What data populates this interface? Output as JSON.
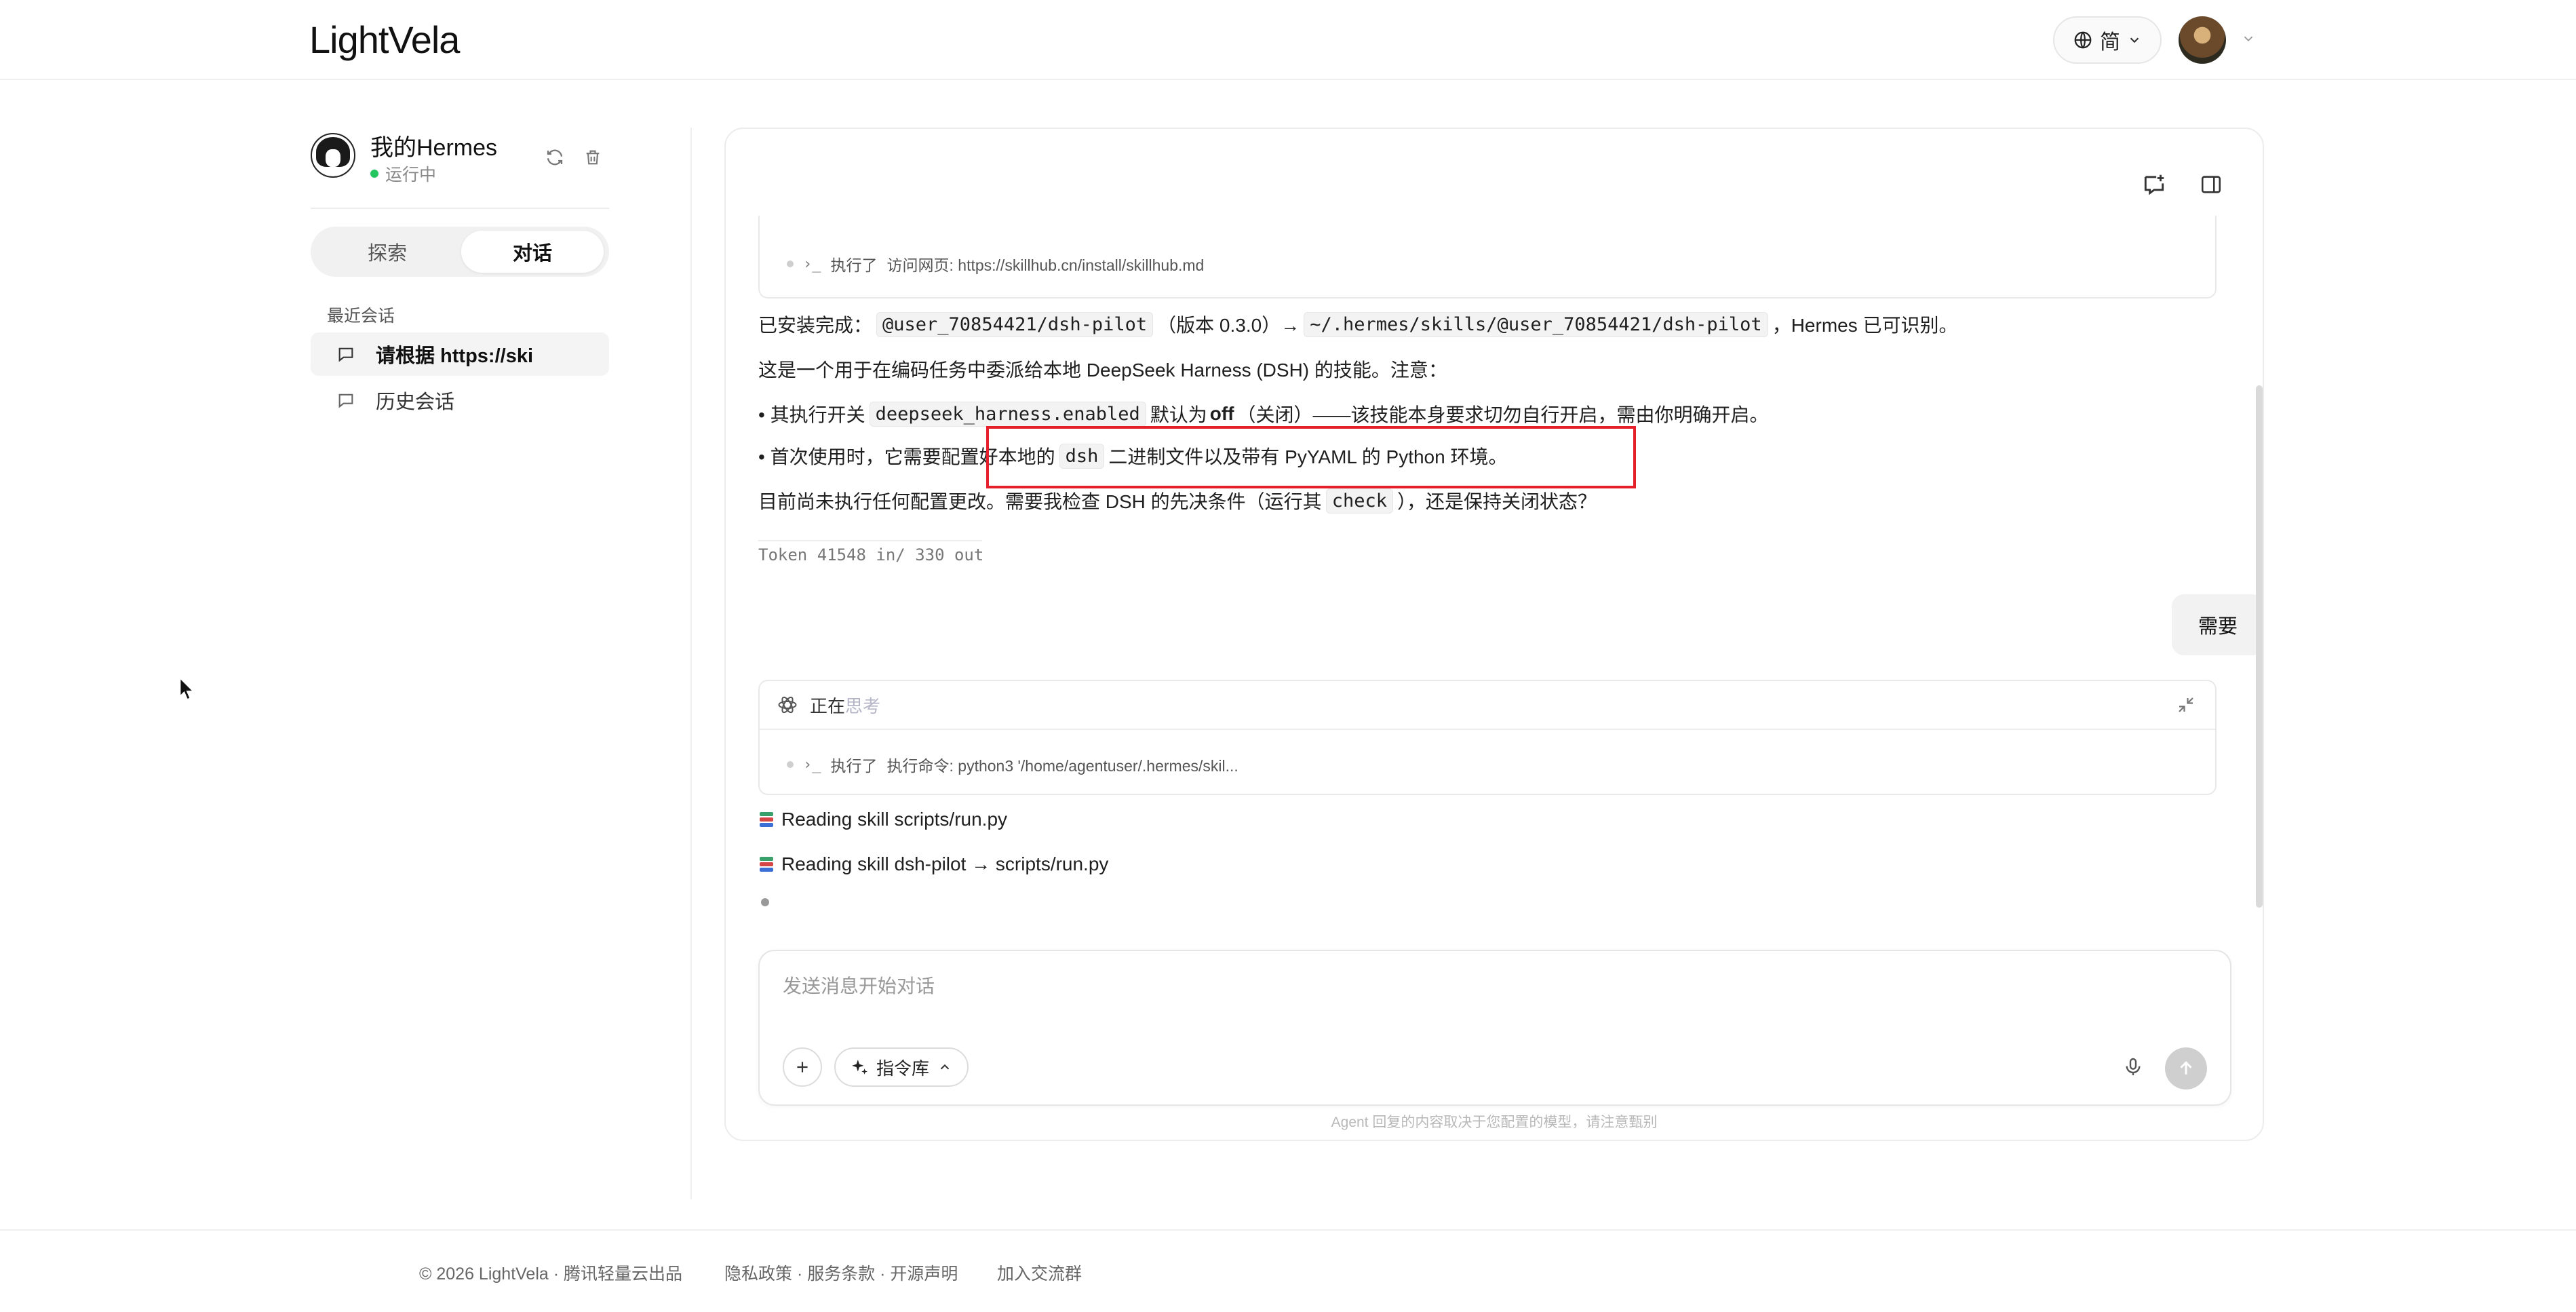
{
  "header": {
    "logo": "LightVela",
    "lang_label": "简"
  },
  "sidebar": {
    "agent_name": "我的Hermes",
    "agent_status": "运行中",
    "tabs": [
      {
        "label": "探索",
        "active": false
      },
      {
        "label": "对话",
        "active": true
      }
    ],
    "recent_label": "最近会话",
    "conversations": [
      {
        "label": "请根据 https://ski",
        "active": true
      },
      {
        "label": "历史会话",
        "active": false
      }
    ]
  },
  "chat": {
    "tool_call_1": {
      "prefix": "执行了",
      "text": "访问网页: https://skillhub.cn/install/skillhub.md"
    },
    "line1": {
      "a": "已安装完成：",
      "code1": "@user_70854421/dsh-pilot",
      "b": "（版本 0.3.0）→",
      "code2": "~/.hermes/skills/@user_70854421/dsh-pilot",
      "c": "，Hermes 已可识别。"
    },
    "line2": "这是一个用于在编码任务中委派给本地 DeepSeek Harness (DSH) 的技能。注意：",
    "bullet1": {
      "a": "• 其执行开关",
      "code": "deepseek_harness.enabled",
      "b": "默认为",
      "bold": "off",
      "c": "（关闭）——该技能本身要求切勿自行开启，需由你明确开启。"
    },
    "bullet2": {
      "a": "• 首次使用时，它需要配置好本地的",
      "code": "dsh",
      "b": "二进制文件以及带有 PyYAML 的 Python 环境。"
    },
    "line3": {
      "a": "目前尚未执行任何配置更改。需要我检查 DSH 的先决条件（运行其",
      "code": "check",
      "b": "），还是保持关闭状态？"
    },
    "token_line": "Token 41548 in/ 330 out",
    "user_message": "需要",
    "thinking": {
      "label_main": "正在",
      "label_fade": "思考",
      "prefix": "执行了",
      "text": "执行命令: python3 '/home/agentuser/.hermes/skil..."
    },
    "reading_1": "Reading skill scripts/run.py",
    "reading_2": "Reading skill dsh-pilot → scripts/run.py",
    "composer": {
      "placeholder": "发送消息开始对话",
      "command_lib": "指令库"
    },
    "disclaimer": "Agent 回复的内容取决于您配置的模型，请注意甄别"
  },
  "footer": {
    "copyright": "© 2026 LightVela · 腾讯轻量云出品",
    "links": "隐私政策 · 服务条款 · 开源声明",
    "join": "加入交流群"
  },
  "colors": {
    "accent_green": "#22c55e",
    "highlight_red": "#e5202a"
  }
}
